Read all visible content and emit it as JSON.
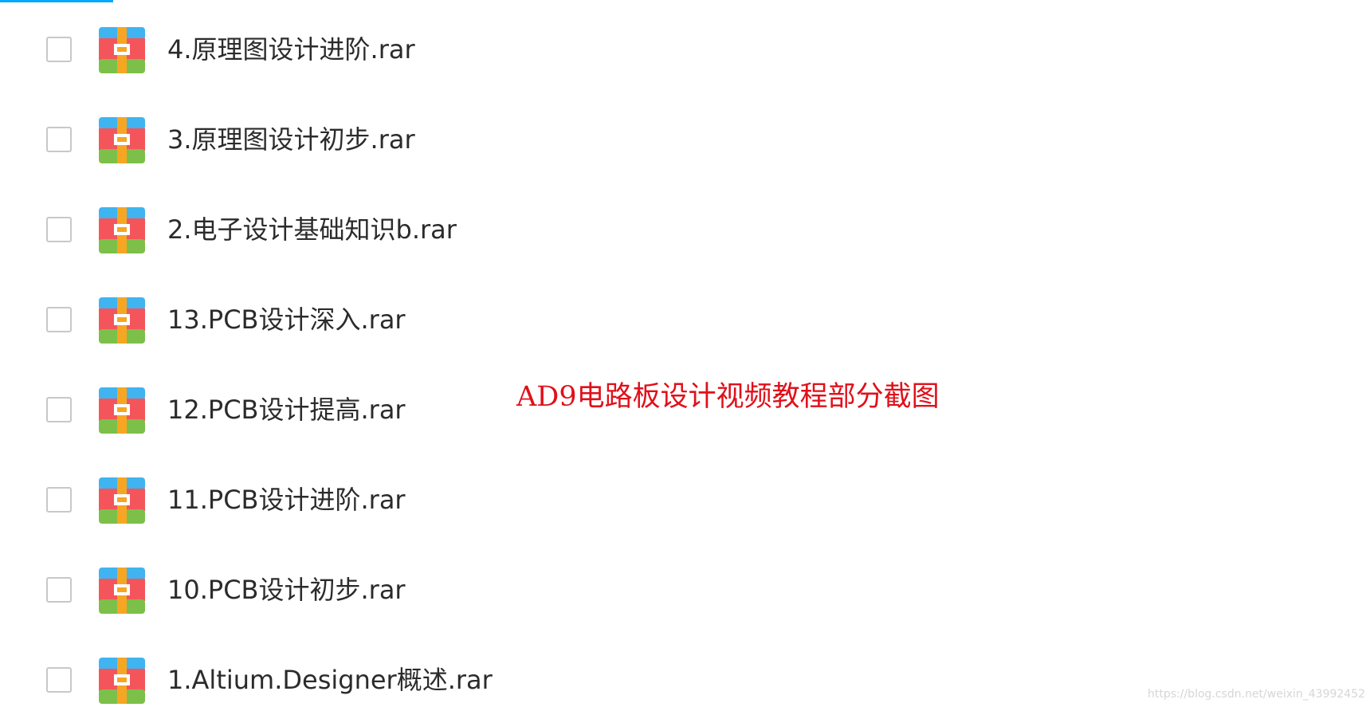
{
  "files": [
    {
      "name": "4.原理图设计进阶.rar",
      "icon": "rar-archive-icon"
    },
    {
      "name": "3.原理图设计初步.rar",
      "icon": "rar-archive-icon"
    },
    {
      "name": "2.电子设计基础知识b.rar",
      "icon": "rar-archive-icon"
    },
    {
      "name": "13.PCB设计深入.rar",
      "icon": "rar-archive-icon"
    },
    {
      "name": "12.PCB设计提高.rar",
      "icon": "rar-archive-icon"
    },
    {
      "name": "11.PCB设计进阶.rar",
      "icon": "rar-archive-icon"
    },
    {
      "name": "10.PCB设计初步.rar",
      "icon": "rar-archive-icon"
    },
    {
      "name": "1.Altium.Designer概述.rar",
      "icon": "rar-archive-icon"
    }
  ],
  "caption": "AD9电路板设计视频教程部分截图",
  "watermark": "https://blog.csdn.net/weixin_43992452",
  "colors": {
    "accent": "#06a7ff",
    "caption": "#e0101a",
    "icon_blue": "#3fb4f0",
    "icon_red": "#f4555a",
    "icon_green": "#7cc04a",
    "icon_orange": "#f6a623"
  }
}
